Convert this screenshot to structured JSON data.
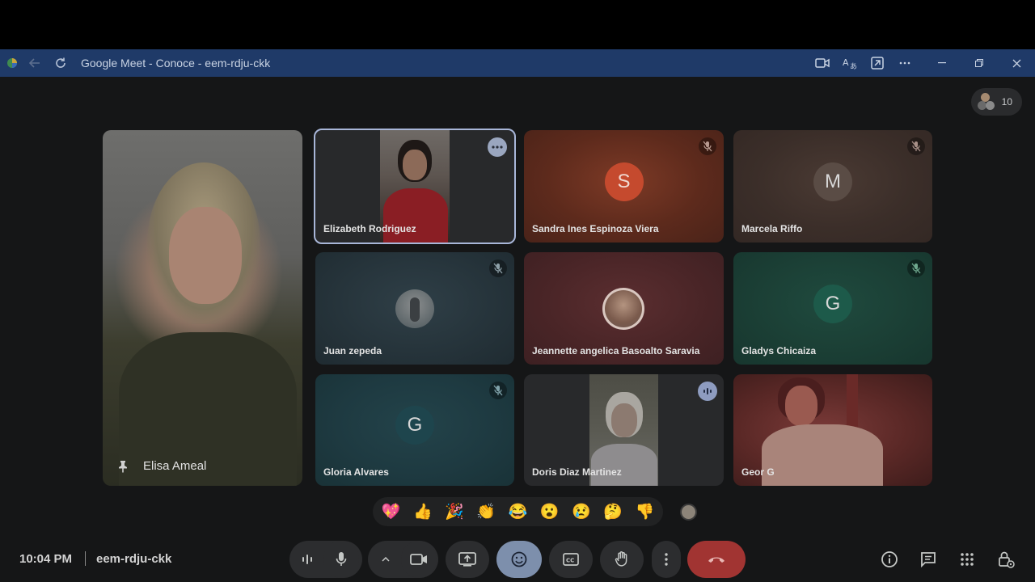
{
  "window": {
    "title": "Google Meet - Conoce - eem-rdju-ckk",
    "icons": [
      "app-icon",
      "back-icon",
      "refresh-icon"
    ],
    "right_icons": [
      "camera-icon",
      "translate-icon",
      "screen-cast-icon",
      "more-icon"
    ],
    "controls": [
      "minimize",
      "restore",
      "close"
    ]
  },
  "participants_chip": {
    "count": "10"
  },
  "main_tile": {
    "name": "Elisa Ameal",
    "pinned": true
  },
  "tiles": [
    {
      "name": "Elizabeth Rodriguez",
      "type": "video",
      "speaking": true,
      "more_options": true
    },
    {
      "name": "Sandra Ines Espinoza Viera",
      "type": "avatar",
      "initial": "S",
      "muted": true,
      "avatar_color": "#c54a2e"
    },
    {
      "name": "Marcela Riffo",
      "type": "avatar",
      "initial": "M",
      "muted": true,
      "avatar_color": "#6a5a50"
    },
    {
      "name": "Juan zepeda",
      "type": "photo",
      "muted": true
    },
    {
      "name": "Jeannette angelica Basoalto Saravia",
      "type": "photo",
      "muted": false
    },
    {
      "name": "Gladys Chicaiza",
      "type": "avatar",
      "initial": "G",
      "muted": true,
      "avatar_color": "#1d5a4a"
    },
    {
      "name": "Gloria Alvares",
      "type": "avatar",
      "initial": "G",
      "muted": true,
      "avatar_color": "#1e454d"
    },
    {
      "name": "Doris Diaz Martinez",
      "type": "video",
      "audio_active": true
    },
    {
      "name": "Geor G",
      "type": "video"
    }
  ],
  "reactions": [
    "💖",
    "👍",
    "🎉",
    "👏",
    "😂",
    "😮",
    "😢",
    "🤔",
    "👎"
  ],
  "bottom_bar": {
    "time": "10:04 PM",
    "separator": "|",
    "meeting_code": "eem-rdju-ckk"
  },
  "colors": {
    "end_call": "#a13432",
    "active_button": "#7d8fac",
    "speaking_border": "#a8b6d8"
  }
}
